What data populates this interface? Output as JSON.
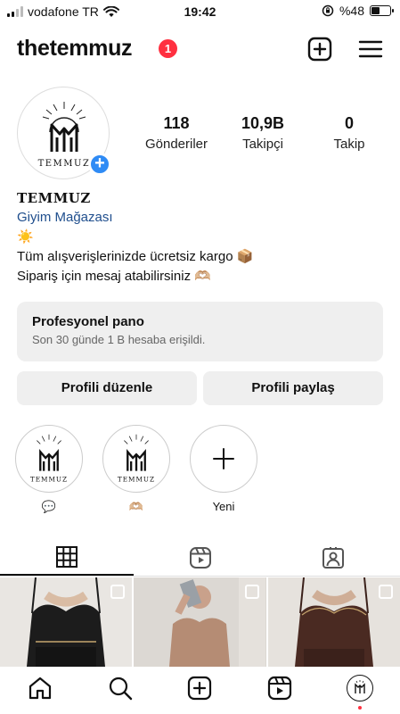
{
  "status_bar": {
    "carrier": "vodafone TR",
    "time": "19:42",
    "battery": "%48",
    "battery_level": 0.48
  },
  "header": {
    "username": "thetemmuz",
    "notification_count": "1",
    "icons": [
      "plus-square-icon",
      "menu-icon"
    ]
  },
  "profile": {
    "avatar_text": "TEMMUZ",
    "stats": [
      {
        "value": "118",
        "label": "Gönderiler"
      },
      {
        "value": "10,9B",
        "label": "Takipçi"
      },
      {
        "value": "0",
        "label": "Takip"
      }
    ],
    "bio": {
      "name": "TEMMUZ",
      "category": "Giyim Mağazası",
      "line1": "☀️",
      "line2": "Tüm alışverişlerinizde ücretsiz kargo 📦",
      "line3": "Sipariş için mesaj atabilirsiniz 🫶🏼"
    }
  },
  "professional_dashboard": {
    "title": "Profesyonel pano",
    "subtitle": "Son 30 günde 1 B hesaba erişildi."
  },
  "buttons": {
    "edit_profile": "Profili düzenle",
    "share_profile": "Profili paylaş"
  },
  "highlights": [
    {
      "caption": "💬",
      "text": "TEMMUZ"
    },
    {
      "caption": "🫶🏼",
      "text": "TEMMUZ"
    },
    {
      "caption": "Yeni"
    }
  ],
  "tabs": [
    "grid-icon",
    "reels-icon",
    "tagged-icon"
  ],
  "grid": {
    "colors": [
      "#1c1c1c",
      "#b58c74",
      "#4a2a22"
    ]
  },
  "bottom_nav": [
    "home-icon",
    "search-icon",
    "create-icon",
    "reels-icon",
    "profile-avatar"
  ]
}
